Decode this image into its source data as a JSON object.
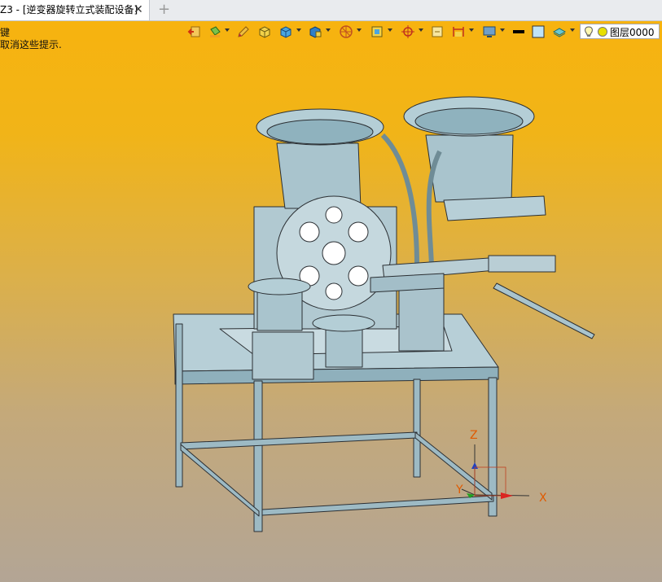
{
  "tab": {
    "title": "Z3 - [逆变器旋转立式装配设备]",
    "close_glyph": "✕",
    "add_glyph": "+"
  },
  "hints": {
    "line1": "键",
    "line2": "取消这些提示."
  },
  "toolbar": {
    "icons": [
      "exit-icon",
      "paint-bucket-icon",
      "pencil-icon",
      "box-yellow-icon",
      "cube-blue-icon",
      "view-cube-icon",
      "section-wheel-icon",
      "view-frame-icon",
      "crosshair-icon",
      "fit-view-icon",
      "dimension-icon",
      "display-icon",
      "line-color-icon",
      "fill-color-icon",
      "layer-stack-icon"
    ]
  },
  "layer": {
    "label": "图层0000"
  },
  "axes": {
    "x": "X",
    "y": "Y",
    "z": "Z"
  },
  "colors": {
    "viewport_top": "#f7b30f",
    "viewport_bottom": "#b3a595",
    "model": "#a9c4cd",
    "edge": "#2b2f33"
  }
}
